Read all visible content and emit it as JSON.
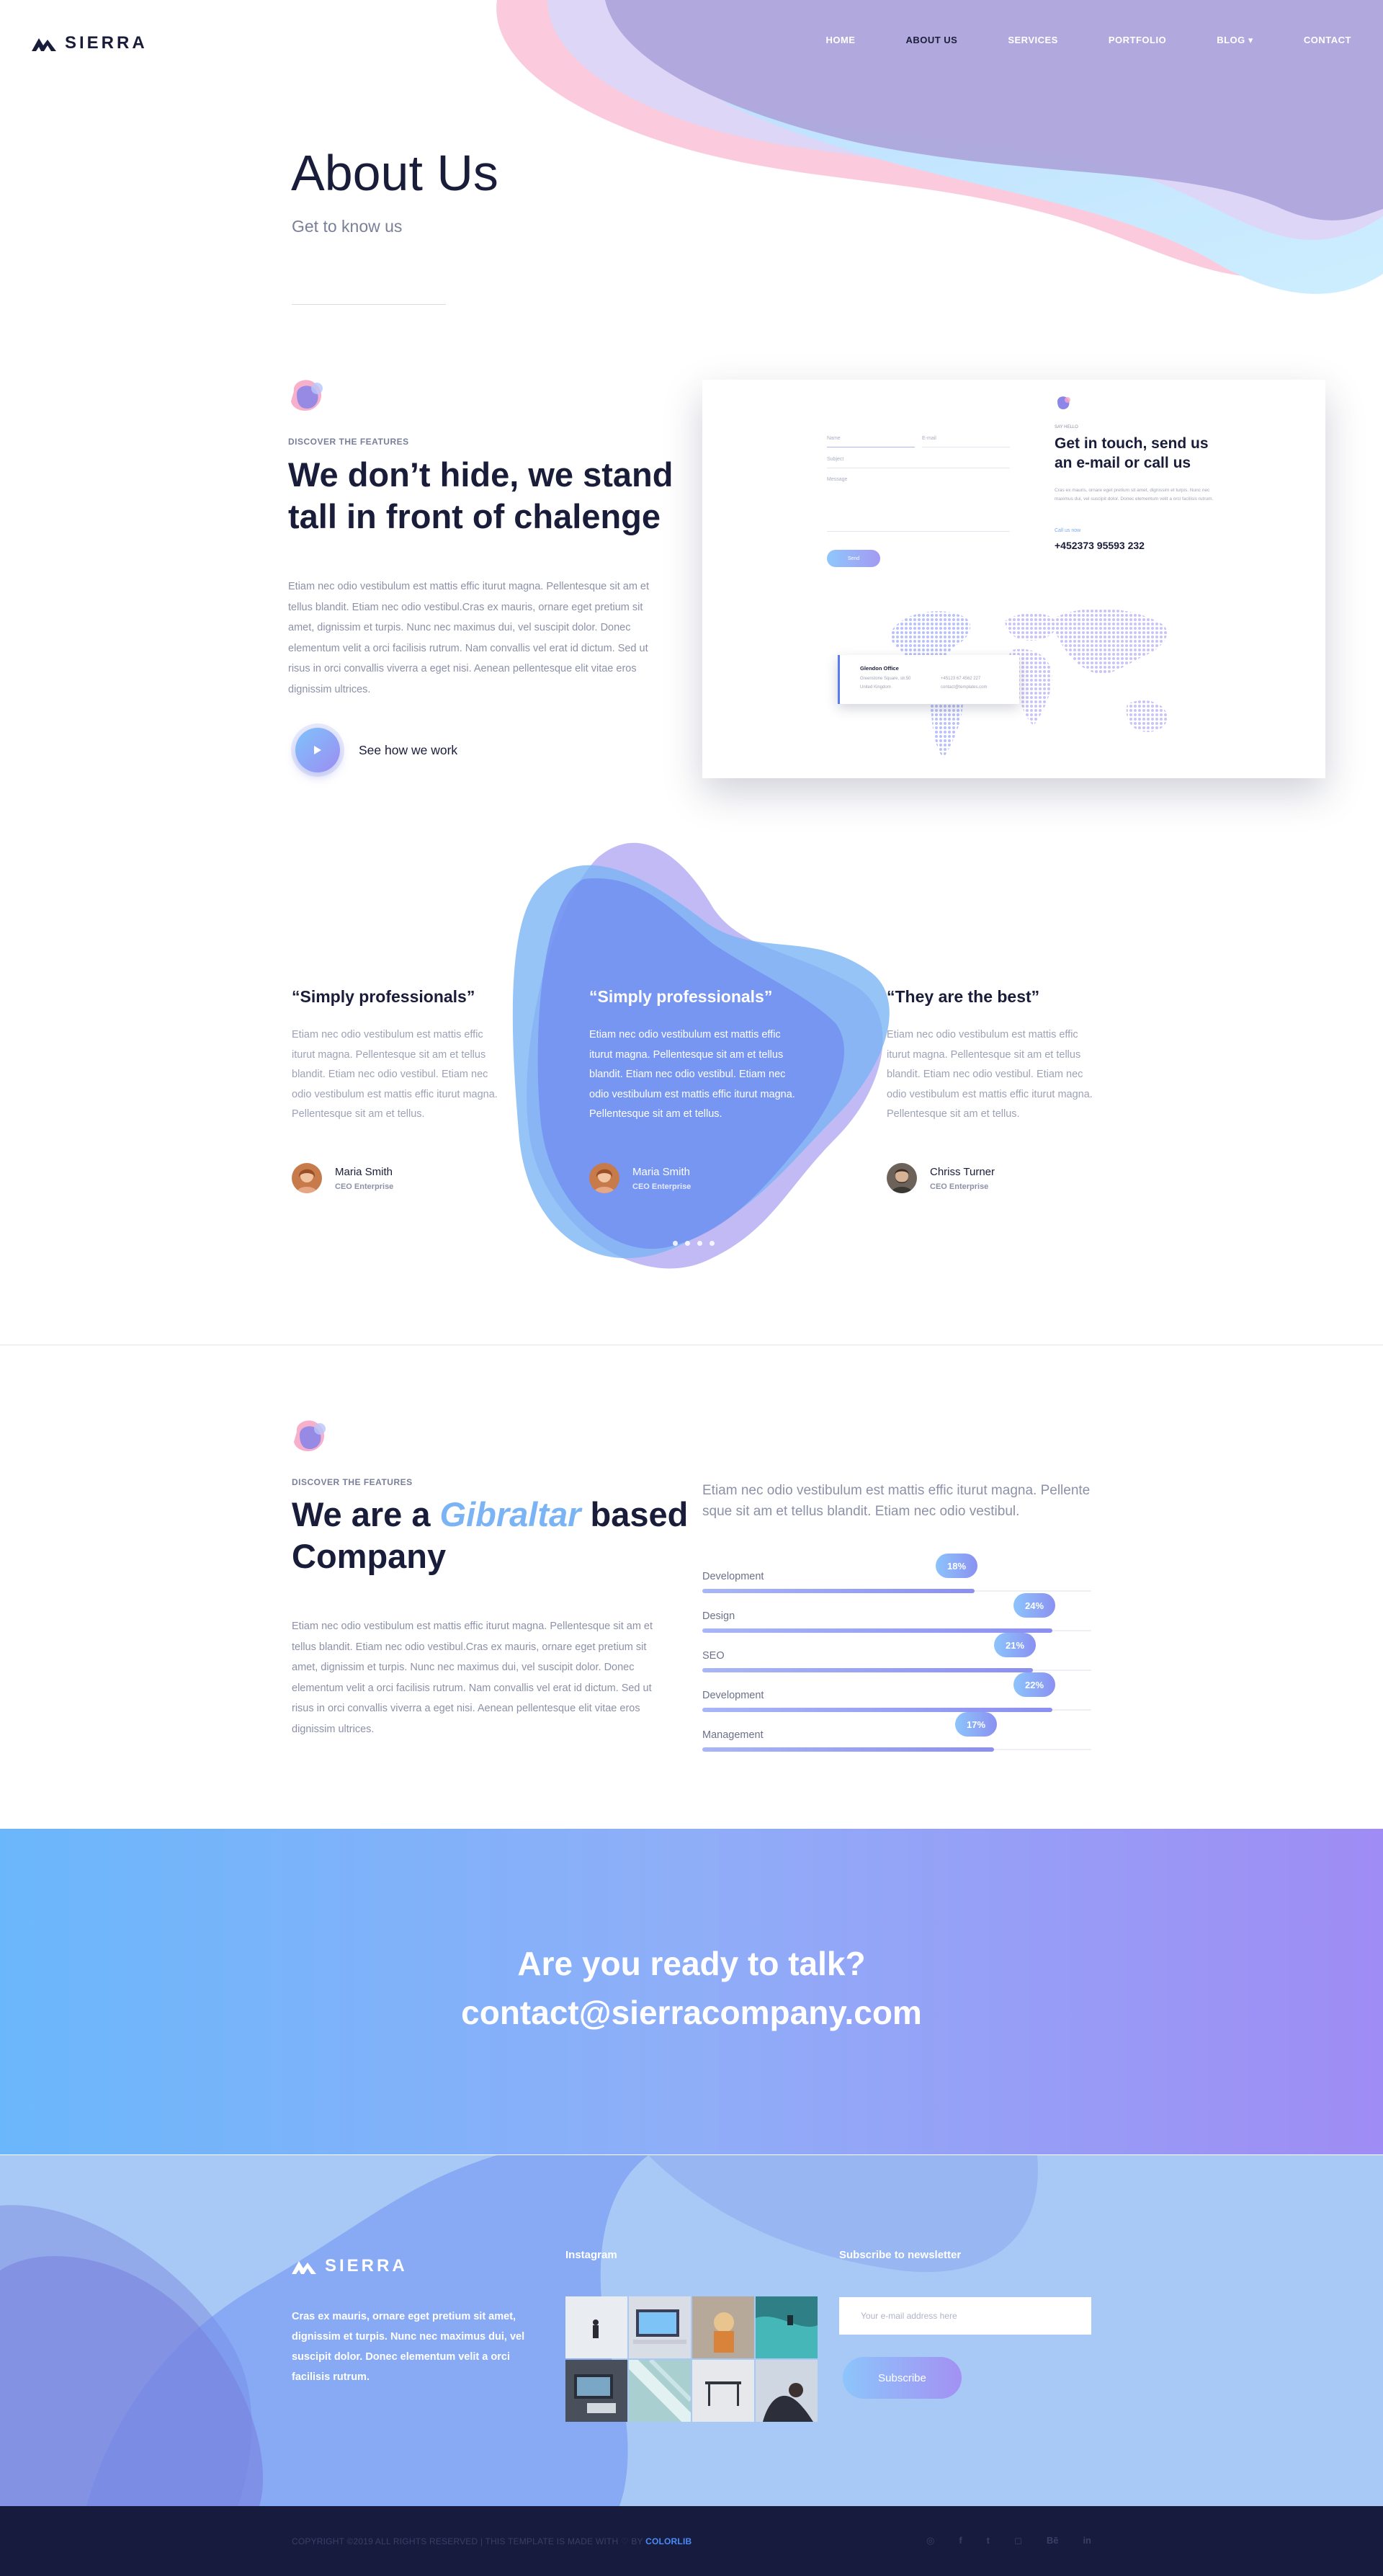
{
  "brand": {
    "name": "SIERRA"
  },
  "nav": {
    "items": [
      {
        "label": "HOME"
      },
      {
        "label": "ABOUT US"
      },
      {
        "label": "SERVICES"
      },
      {
        "label": "PORTFOLIO"
      },
      {
        "label": "BLOG ▾"
      },
      {
        "label": "CONTACT"
      }
    ],
    "active": "ABOUT US"
  },
  "hero": {
    "title": "About Us",
    "subtitle": "Get to know us"
  },
  "features1": {
    "eyebrow": "DISCOVER THE FEATURES",
    "title_line1": "We don’t hide, we stand",
    "title_line2": "tall in front of chalenge",
    "body": "Etiam nec odio vestibulum est mattis effic iturut magna. Pellentesque sit am et tellus blandit. Etiam nec odio vestibul.Cras ex mauris, ornare eget pretium sit amet, dignissim et turpis. Nunc nec maximus dui, vel suscipit dolor. Donec elementum velit a orci facilisis rutrum. Nam convallis vel erat id dictum. Sed ut risus in orci convallis viverra a eget nisi. Aenean pellentesque elit vitae eros dignissim ultrices.",
    "play_label": "See how we work"
  },
  "contact_card": {
    "labels": {
      "name": "Name",
      "email": "E-mail",
      "subject": "Subject",
      "message": "Message"
    },
    "send": "Send",
    "say_hello": "SAY HELLO",
    "title_line1": "Get in touch, send us",
    "title_line2": "an e-mail or call us",
    "desc": "Cras ex mauris, ornare eget pretium sit amet, dignissim et turpis. Nunc nec maximus dui, vel suscipit dolor. Donec elementum velit a orci facilisis rutrum.",
    "call_label": "Call us now",
    "phone": "+452373 95593 232",
    "office": {
      "name": "Glendon Office",
      "addr1": "Greenstone Square, str.50",
      "addr2": "United Kingdom",
      "phone": "+45123 67 4562 227",
      "email": "contact@templates.com"
    }
  },
  "testimonials": [
    {
      "quote": "“Simply professionals”",
      "text": "Etiam nec odio vestibulum est mattis effic iturut magna. Pellentesque sit am et tellus blandit. Etiam nec odio vestibul. Etiam nec odio vestibulum est mattis effic iturut magna. Pellentesque sit am et tellus.",
      "name": "Maria Smith",
      "role": "CEO Enterprise"
    },
    {
      "quote": "“Simply professionals”",
      "text": "Etiam nec odio vestibulum est mattis effic iturut magna. Pellentesque sit am et tellus blandit. Etiam nec odio vestibul. Etiam nec odio vestibulum est mattis effic iturut magna. Pellentesque sit am et tellus.",
      "name": "Maria Smith",
      "role": "CEO Enterprise"
    },
    {
      "quote": "“They are the best”",
      "text": "Etiam nec odio vestibulum est mattis effic iturut magna. Pellentesque sit am et tellus blandit. Etiam nec odio vestibul. Etiam nec odio vestibulum est mattis effic iturut magna. Pellentesque sit am et tellus.",
      "name": "Chriss Turner",
      "role": "CEO Enterprise"
    }
  ],
  "features2": {
    "eyebrow": "DISCOVER THE FEATURES",
    "title_pre": "We are a",
    "title_highlight": "Gibraltar",
    "title_post": "based",
    "title_line2": "Company",
    "body": "Etiam nec odio vestibulum est mattis effic iturut magna. Pellentesque sit am et tellus blandit. Etiam nec odio vestibul.Cras ex mauris, ornare eget pretium sit amet, dignissim et turpis. Nunc nec maximus dui, vel suscipit dolor. Donec elementum velit a orci facilisis rutrum. Nam convallis vel erat id dictum. Sed ut risus in orci convallis viverra a eget nisi. Aenean pellentesque elit vitae eros dignissim ultrices.",
    "skills_intro": "Etiam nec odio vestibulum est mattis effic iturut magna. Pellente sque sit am et tellus blandit. Etiam nec odio vestibul.",
    "skills": [
      {
        "label": "Development",
        "badge": "18%",
        "fill": 0.7
      },
      {
        "label": "Design",
        "badge": "24%",
        "fill": 0.9
      },
      {
        "label": "SEO",
        "badge": "21%",
        "fill": 0.85
      },
      {
        "label": "Development",
        "badge": "22%",
        "fill": 0.9
      },
      {
        "label": "Management",
        "badge": "17%",
        "fill": 0.75
      }
    ]
  },
  "cta": {
    "line1": "Are you ready to talk?",
    "line2": "contact@sierracompany.com"
  },
  "footer": {
    "about": "Cras ex mauris, ornare eget pretium sit amet, dignissim et turpis. Nunc nec maximus dui, vel suscipit dolor. Donec elementum velit a orci facilisis rutrum.",
    "instagram_title": "Instagram",
    "newsletter_title": "Subscribe to newsletter",
    "email_placeholder": "Your e-mail address here",
    "subscribe_label": "Subscribe",
    "copyright_pre": "COPYRIGHT ©2019 ALL RIGHTS RESERVED | THIS TEMPLATE IS MADE WITH ♡ BY",
    "copyright_brand": "COLORLIB",
    "social": [
      "dribbble-icon",
      "facebook-icon",
      "twitter-icon",
      "instagram-icon",
      "behance-icon",
      "linkedin-icon"
    ]
  },
  "colors": {
    "navy": "#1a1d3a",
    "accent_blue": "#7ab4f4",
    "accent_purple": "#9d8cf2",
    "cta_start": "#6bb7fb",
    "cta_end": "#9f8cf4",
    "footer_bg": "#a8c9f6",
    "bottom_bar": "#171b3d"
  }
}
